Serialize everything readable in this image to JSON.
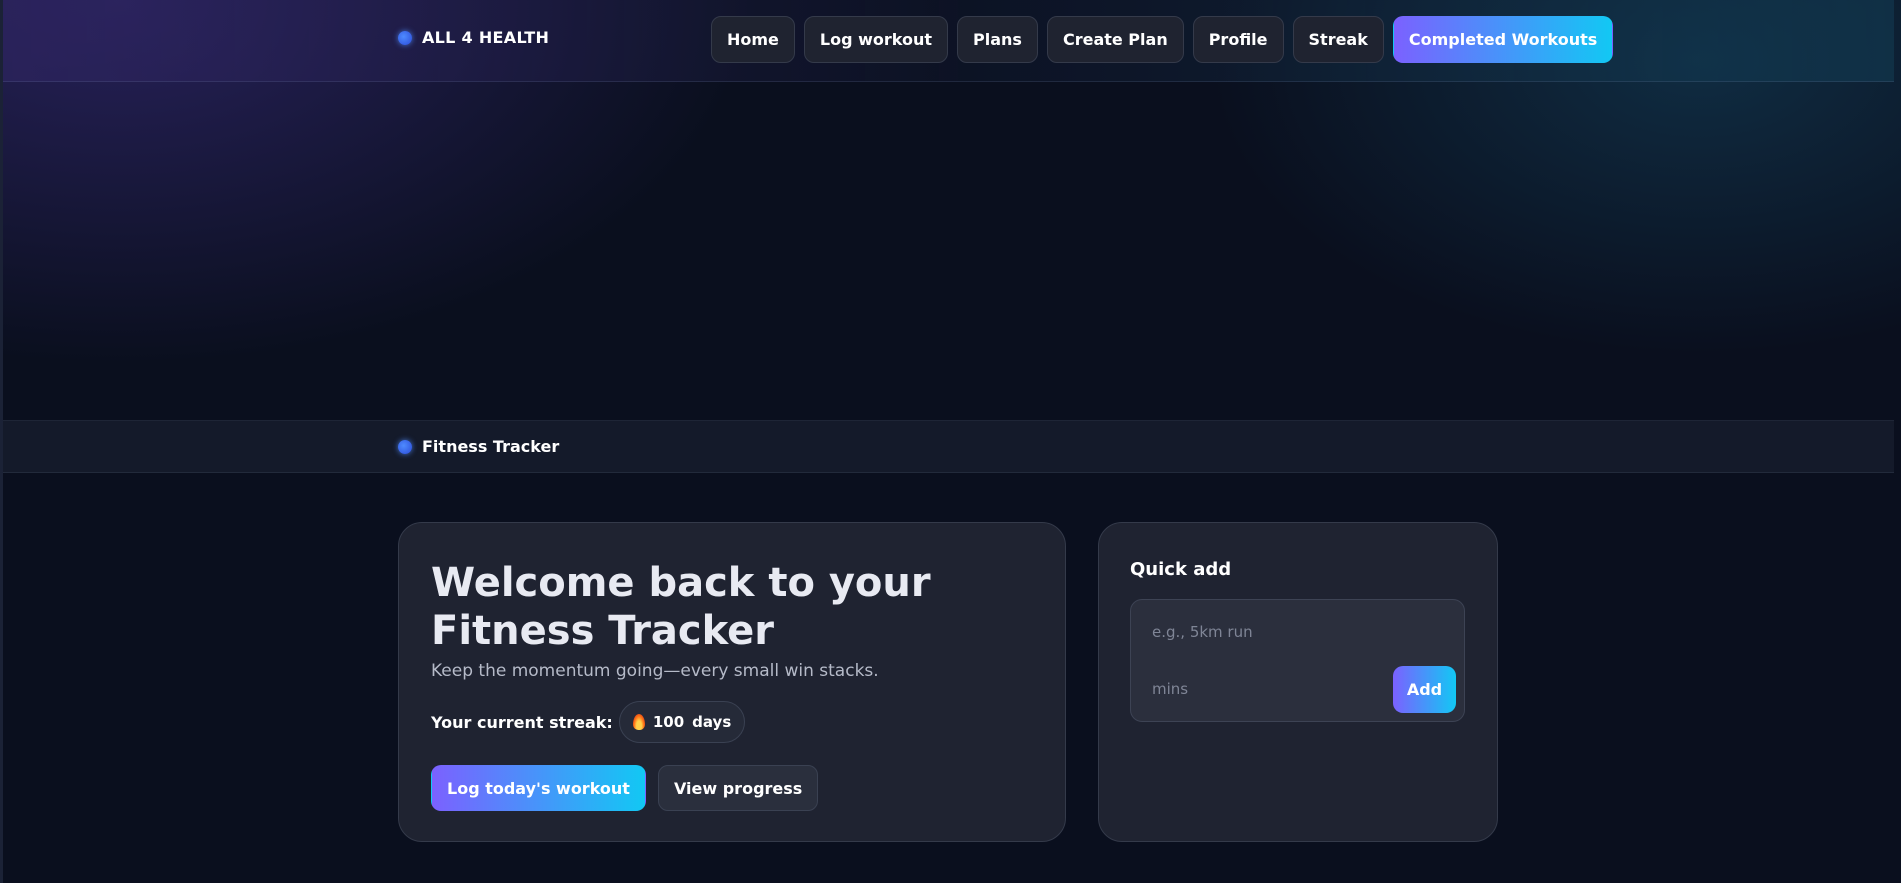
{
  "brand": {
    "name": "ALL 4 HEALTH"
  },
  "nav": {
    "items": [
      {
        "label": "Home"
      },
      {
        "label": "Log workout"
      },
      {
        "label": "Plans"
      },
      {
        "label": "Create Plan"
      },
      {
        "label": "Profile"
      },
      {
        "label": "Streak"
      },
      {
        "label": "Completed Workouts"
      }
    ],
    "active": "Completed Workouts"
  },
  "section": {
    "title": "Fitness Tracker"
  },
  "hero": {
    "title": "Welcome back to your Fitness Tracker",
    "subtitle": "Keep the momentum going—every small win stacks.",
    "streak_label": "Your current streak:",
    "streak_value": "100",
    "streak_unit": "days",
    "primary_action": "Log today's workout",
    "secondary_action": "View progress"
  },
  "quick_add": {
    "title": "Quick add",
    "workout_placeholder": "e.g., 5km run",
    "minutes_placeholder": "mins",
    "add_label": "Add"
  },
  "colors": {
    "accent_start": "#7b61ff",
    "accent_end": "#12c8f4",
    "background": "#0a0f1e",
    "card": "#1f2331"
  },
  "icons": {
    "brand": "dot-icon",
    "streak": "flame-icon"
  }
}
